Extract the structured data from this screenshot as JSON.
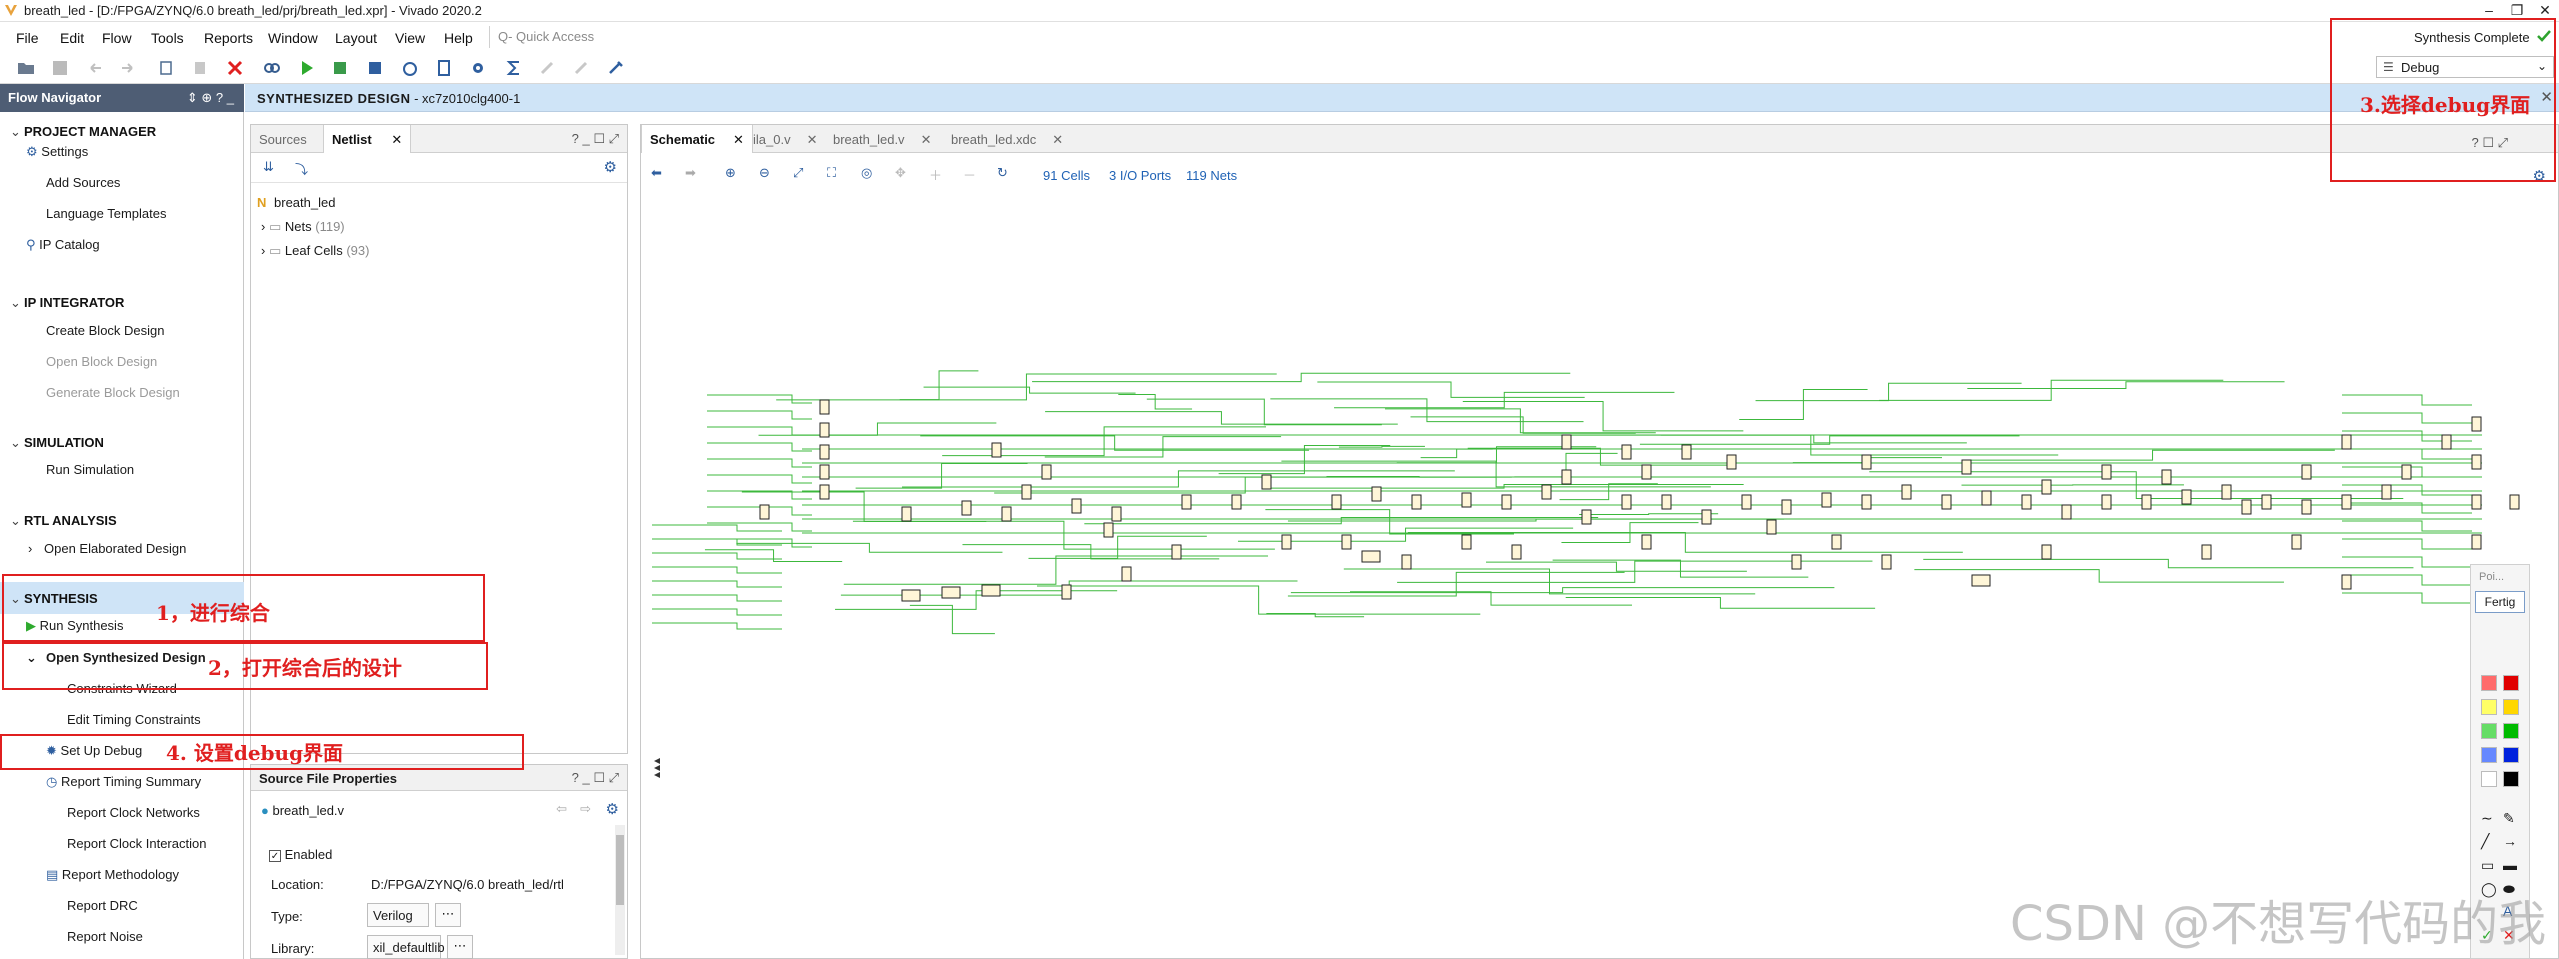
{
  "window": {
    "title": "breath_led - [D:/FPGA/ZYNQ/6.0 breath_led/prj/breath_led.xpr] - Vivado 2020.2"
  },
  "menu": [
    "File",
    "Edit",
    "Flow",
    "Tools",
    "Reports",
    "Window",
    "Layout",
    "View",
    "Help"
  ],
  "quick_access_placeholder": "Q- Quick Access",
  "status": {
    "text": "Synthesis Complete",
    "layout": "Debug"
  },
  "flow_navigator": {
    "title": "Flow Navigator",
    "sections": {
      "project_manager": {
        "title": "PROJECT MANAGER",
        "items": [
          "Settings",
          "Add Sources",
          "Language Templates",
          "IP Catalog"
        ]
      },
      "ip_integrator": {
        "title": "IP INTEGRATOR",
        "items": [
          "Create Block Design",
          "Open Block Design",
          "Generate Block Design"
        ]
      },
      "simulation": {
        "title": "SIMULATION",
        "items": [
          "Run Simulation"
        ]
      },
      "rtl_analysis": {
        "title": "RTL ANALYSIS",
        "items": [
          "Open Elaborated Design"
        ]
      },
      "synthesis": {
        "title": "SYNTHESIS",
        "run": "Run Synthesis",
        "open": "Open Synthesized Design",
        "sub": [
          "Constraints Wizard",
          "Edit Timing Constraints",
          "Set Up Debug",
          "Report Timing Summary",
          "Report Clock Networks",
          "Report Clock Interaction",
          "Report Methodology",
          "Report DRC",
          "Report Noise"
        ]
      }
    }
  },
  "banner": {
    "title": "SYNTHESIZED DESIGN",
    "part": "- xc7z010clg400-1"
  },
  "netlist_panel": {
    "tabs": [
      "Sources",
      "Netlist"
    ],
    "controls": "? _ ☐ ⤢",
    "root": "breath_led",
    "nets": {
      "label": "Nets",
      "count": "(119)"
    },
    "leaf_cells": {
      "label": "Leaf Cells",
      "count": "(93)"
    }
  },
  "source_props": {
    "title": "Source File Properties",
    "file": "breath_led.v",
    "enabled": "Enabled",
    "location_label": "Location:",
    "location_value": "D:/FPGA/ZYNQ/6.0 breath_led/rtl",
    "type_label": "Type:",
    "type_value": "Verilog",
    "library_label": "Library:",
    "library_value": "xil_defaultlib"
  },
  "schematic": {
    "tabs": [
      "Schematic",
      "ila_0.v",
      "breath_led.v",
      "breath_led.xdc"
    ],
    "stats": [
      "91 Cells",
      "3 I/O Ports",
      "119 Nets"
    ]
  },
  "annotations": [
    "1，进行综合",
    "2，打开综合后的设计",
    "3.选择debug界面",
    "4. 设置debug界面"
  ],
  "palette": {
    "label": "Poi...",
    "button": "Fertig",
    "colors": [
      "#ff6b6b",
      "#e00000",
      "#ffff66",
      "#ffd700",
      "#66dd66",
      "#00bb00",
      "#6688ff",
      "#0022dd",
      "#ffffff",
      "#000000"
    ]
  },
  "watermark": "CSDN @不想写代码的我"
}
